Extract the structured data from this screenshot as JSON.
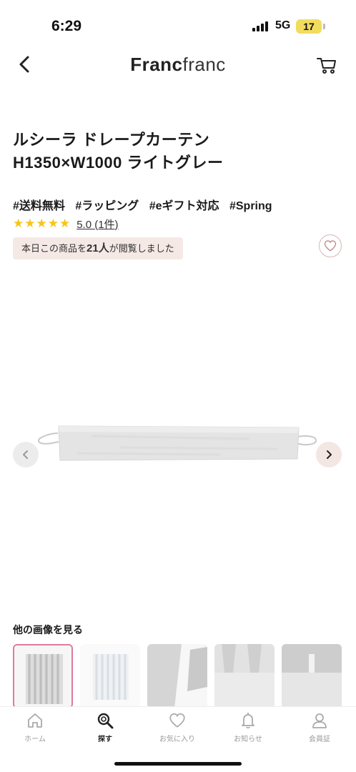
{
  "status_bar": {
    "time": "6:29",
    "network": "5G",
    "battery": "17"
  },
  "header": {
    "logo_bold": "Franc",
    "logo_light": "franc",
    "back_icon": "chevron-left-icon",
    "cart_icon": "cart-icon"
  },
  "product": {
    "title_line1": "ルシーラ ドレープカーテン",
    "title_line2": "H1350×W1000 ライトグレー",
    "tags": [
      "#送料無料",
      "#ラッピング",
      "#eギフト対応",
      "#Spring"
    ],
    "stars": "★★★★★",
    "rating_text": "5.0 (1件)",
    "views_prefix": "本日この商品を",
    "views_count": "21人",
    "views_suffix": "が閲覧しました"
  },
  "gallery": {
    "more_images_label": "他の画像を見る"
  },
  "tabbar": {
    "tabs": [
      {
        "label": "ホーム",
        "icon": "home-icon"
      },
      {
        "label": "探す",
        "icon": "search-icon"
      },
      {
        "label": "お気に入り",
        "icon": "heart-icon"
      },
      {
        "label": "お知らせ",
        "icon": "bell-icon"
      },
      {
        "label": "会員証",
        "icon": "member-card-icon"
      }
    ]
  },
  "colors": {
    "accent_pink": "#e07a9e",
    "star": "#f5c518",
    "views_bg": "#f5e9e6"
  }
}
